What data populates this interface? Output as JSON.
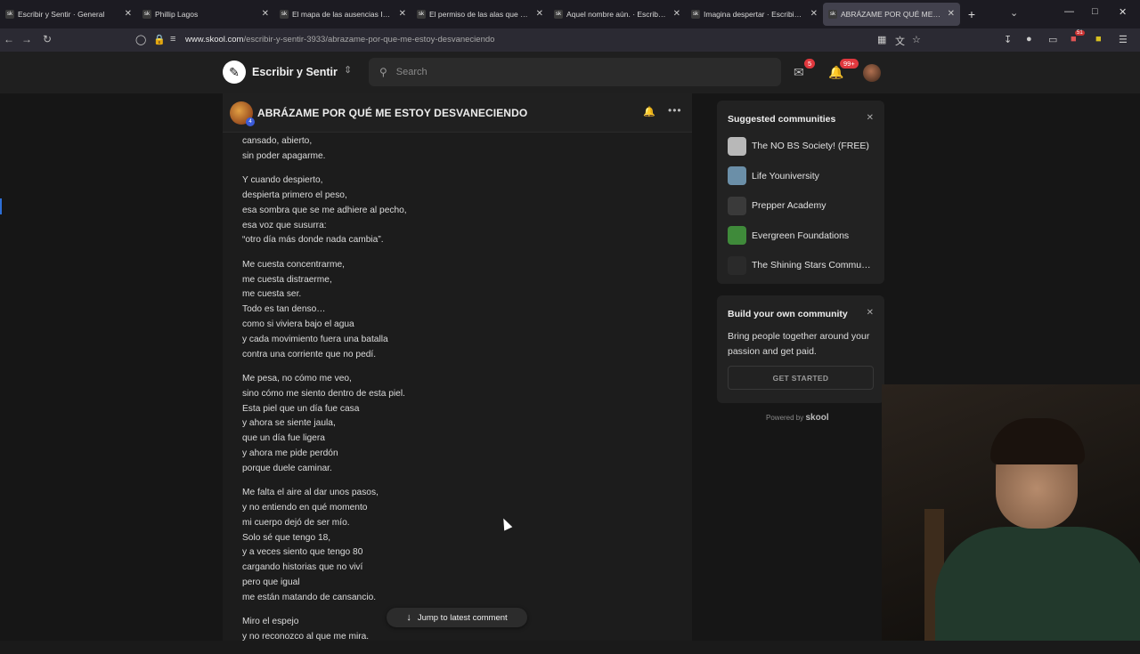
{
  "browser": {
    "tabs": [
      {
        "title": "Escribir y Sentir · General",
        "active": false
      },
      {
        "title": "Phillip Lagos",
        "active": false
      },
      {
        "title": "El mapa de las ausencias I · Escr",
        "active": false
      },
      {
        "title": "El permiso de las alas que amé",
        "active": false
      },
      {
        "title": "Aquel nombre aún. · Escribir y S",
        "active": false
      },
      {
        "title": "Imagina despertar · Escribir y Se",
        "active": false
      },
      {
        "title": "ABRÁZAME POR QUÉ ME ESTO",
        "active": true
      }
    ],
    "favicon_text": "sk",
    "url_domain": "www.skool.com",
    "url_path": "/escribir-y-sentir-3933/abrazame-por-que-me-estoy-desvaneciendo",
    "extension_badge": "51"
  },
  "header": {
    "community_name": "Escribir y Sentir",
    "search_placeholder": "Search",
    "chat_badge": "5",
    "notif_badge": "99+"
  },
  "post": {
    "title": "ABRÁZAME POR QUÉ ME ESTOY DESVANECIENDO",
    "author_level": "4",
    "stanzas": [
      [
        "cansado, abierto,",
        "sin poder apagarme."
      ],
      [
        "Y cuando despierto,",
        "despierta primero el peso,",
        "esa sombra que se me adhiere al pecho,",
        "esa voz que susurra:",
        "“otro día más donde nada cambia”."
      ],
      [
        "Me cuesta concentrarme,",
        "me cuesta distraerme,",
        "me cuesta ser.",
        "Todo es tan denso…",
        "como si viviera bajo el agua",
        "y cada movimiento fuera una batalla",
        "contra una corriente que no pedí."
      ],
      [
        "Me pesa, no cómo me veo,",
        "sino cómo me siento dentro de esta piel.",
        "Esta piel que un día fue casa",
        "y ahora se siente jaula,",
        "que un día fue ligera",
        "y ahora me pide perdón",
        "porque duele caminar."
      ],
      [
        "Me falta el aire al dar unos pasos,",
        "y no entiendo en qué momento",
        "mi cuerpo dejó de ser mío.",
        "Solo sé que tengo 18,",
        "y a veces siento que tengo 80",
        "cargando historias que no viví",
        "pero que igual",
        "me están matando de cansancio."
      ],
      [
        "Miro el espejo",
        "y no reconozco al que me mira."
      ]
    ],
    "jump_label": "Jump to latest comment"
  },
  "suggested": {
    "title": "Suggested communities",
    "items": [
      {
        "name": "The NO BS Society! (FREE)",
        "color": "#b8b8b8"
      },
      {
        "name": "Life Youniversity",
        "color": "#6b8fa8"
      },
      {
        "name": "Prepper Academy",
        "color": "#3a3a3a"
      },
      {
        "name": "Evergreen Foundations",
        "color": "#3f8a3a"
      },
      {
        "name": "The Shining Stars Commu…",
        "color": "#2a2a2a"
      }
    ]
  },
  "build": {
    "title": "Build your own community",
    "text": "Bring people together around your passion and get paid.",
    "button": "GET STARTED"
  },
  "footer": {
    "powered_by": "Powered by",
    "brand": "skool"
  }
}
